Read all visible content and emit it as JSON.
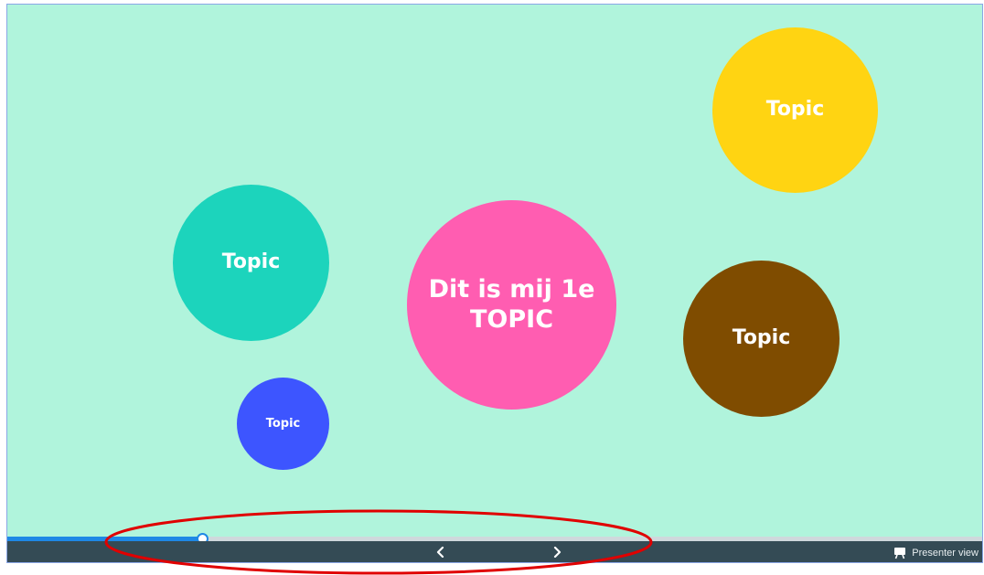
{
  "colors": {
    "canvas": "#b0f4dc",
    "toolbar": "#344b55",
    "progress": "#1e88e5",
    "annotation": "#e00000"
  },
  "topics": {
    "yellow": {
      "label": "Topic",
      "color": "#ffd412"
    },
    "teal": {
      "label": "Topic",
      "color": "#1cd4bc"
    },
    "pink": {
      "label_line1": "Dit is mij 1e",
      "label_line2": "TOPIC",
      "color": "#ff5db1"
    },
    "brown": {
      "label": "Topic",
      "color": "#7f4c00"
    },
    "blue": {
      "label": "Topic",
      "color": "#3d55ff"
    }
  },
  "progress": {
    "fraction": 0.2
  },
  "toolbar": {
    "prev_icon": "chevron-left-icon",
    "next_icon": "chevron-right-icon",
    "presenter_icon": "presentation-board-icon",
    "presenter_label": "Presenter view"
  }
}
